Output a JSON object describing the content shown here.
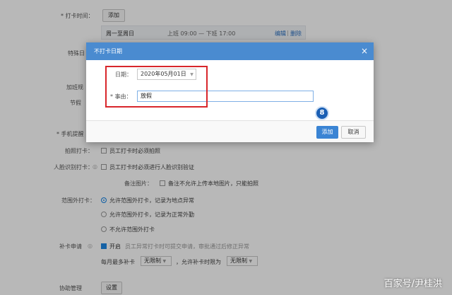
{
  "background": {
    "punch_time_label": "* 打卡时间：",
    "add_button": "添加",
    "schedule": {
      "days": "周一至周日",
      "hours": "上班 09:00 — 下班 17:00",
      "edit": "编辑",
      "separator": "|",
      "delete": "删除"
    },
    "special_date_label": "特殊日",
    "overtime_label": "加班规",
    "holiday_label": "节假",
    "phone_remind_label": "* 手机提醒",
    "photo_punch_label": "拍照打卡：",
    "photo_punch_option": "员工打卡时必须拍照",
    "face_punch_label": "人脸识别打卡：",
    "face_punch_option": "员工打卡时必须进行人脸识别验证",
    "remark_image_label": "备注图片：",
    "remark_image_option": "备注不允许上传本地图片，只能拍照",
    "out_of_range_label": "范围外打卡：",
    "out_of_range_options": [
      "允许范围外打卡，记录为地点异常",
      "允许范围外打卡，记录为正常外勤",
      "不允许范围外打卡"
    ],
    "makeup_label": "补卡申请",
    "makeup_on": "开启",
    "makeup_desc": "员工异常打卡时可提交申请，审批通过后修正异常",
    "monthly_max_label": "每月最多补卡",
    "monthly_max_value": "无限制",
    "time_limit_label": "，允许补卡时限为",
    "time_limit_value": "无限制",
    "assist_label": "协助管理",
    "assist_button": "设置"
  },
  "dialog": {
    "title": "不打卡日期",
    "close": "×",
    "date_label": "日期：",
    "date_value": "2020年05月01日",
    "reason_label": "* 事由：",
    "reason_value": "放假",
    "add_button": "添加",
    "cancel_button": "取消"
  },
  "step_badge": "8",
  "watermark": "百家号/尹桂洪"
}
